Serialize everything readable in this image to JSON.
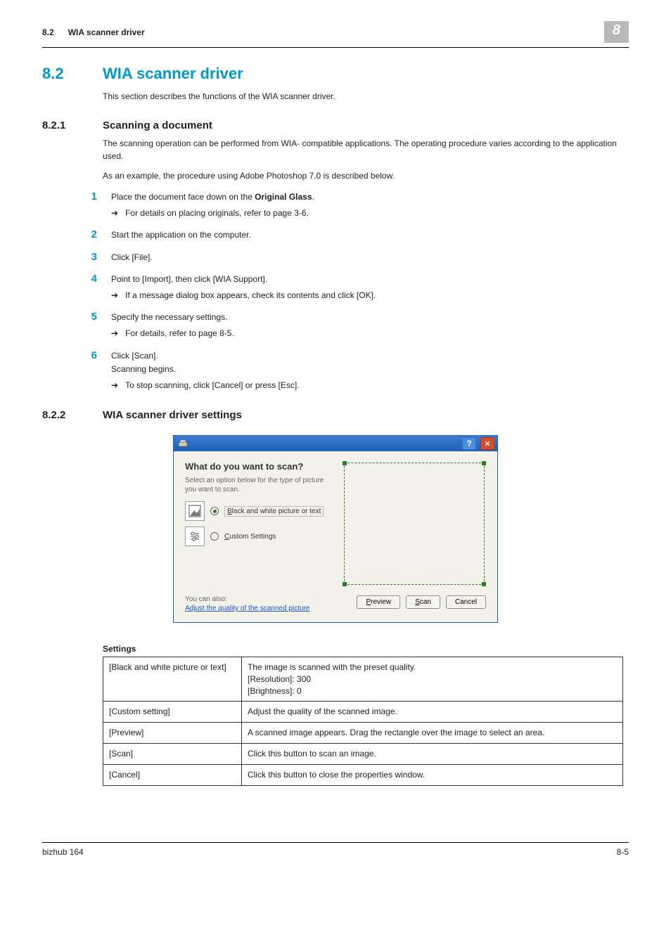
{
  "header": {
    "section_num": "8.2",
    "section_title": "WIA scanner driver",
    "chapter": "8"
  },
  "h2": {
    "num": "8.2",
    "title": "WIA scanner driver",
    "intro": "This section describes the functions of the WIA scanner driver."
  },
  "s821": {
    "num": "8.2.1",
    "title": "Scanning a document",
    "p1": "The scanning operation can be performed from WIA- compatible applications. The operating procedure varies according to the application used.",
    "p2": "As an example, the procedure using Adobe Photoshop 7.0 is described below.",
    "steps": [
      {
        "n": "1",
        "text_pre": "Place the document face down on the ",
        "bold": "Original Glass",
        "text_post": ".",
        "sub": "For details on placing originals, refer to page 3-6."
      },
      {
        "n": "2",
        "text": "Start the application on the computer."
      },
      {
        "n": "3",
        "text": "Click [File]."
      },
      {
        "n": "4",
        "text": "Point to [Import], then click [WIA Support].",
        "sub": "If a message dialog box appears, check its contents and click [OK]."
      },
      {
        "n": "5",
        "text": "Specify the necessary settings.",
        "sub": "For details, refer to page 8-5."
      },
      {
        "n": "6",
        "text": "Click [Scan].",
        "line2": "Scanning begins.",
        "sub": "To stop scanning, click [Cancel] or press [Esc]."
      }
    ]
  },
  "s822": {
    "num": "8.2.2",
    "title": "WIA scanner driver settings"
  },
  "dialog": {
    "heading": "What do you want to scan?",
    "sub": "Select an option below for the type of picture you want to scan.",
    "opt1_pre": "B",
    "opt1_rest": "lack and white picture or text",
    "opt2_pre": "C",
    "opt2_rest": "ustom Settings",
    "also": "You can also:",
    "adjust": "Adjust the quality of the scanned picture",
    "preview_btn_pre": "P",
    "preview_btn_rest": "review",
    "scan_btn_pre": "S",
    "scan_btn_rest": "can",
    "cancel_btn": "Cancel"
  },
  "settings": {
    "caption": "Settings",
    "rows": [
      {
        "k": "[Black and white picture or text]",
        "v": "The image is scanned with the preset quality.\n[Resolution]: 300\n[Brightness]: 0"
      },
      {
        "k": "[Custom setting]",
        "v": "Adjust the quality of the scanned image."
      },
      {
        "k": "[Preview]",
        "v": "A scanned image appears. Drag the rectangle over the image to select an area."
      },
      {
        "k": "[Scan]",
        "v": "Click this button to scan an image."
      },
      {
        "k": "[Cancel]",
        "v": "Click this button to close the properties window."
      }
    ]
  },
  "footer": {
    "product": "bizhub 164",
    "page": "8-5"
  }
}
